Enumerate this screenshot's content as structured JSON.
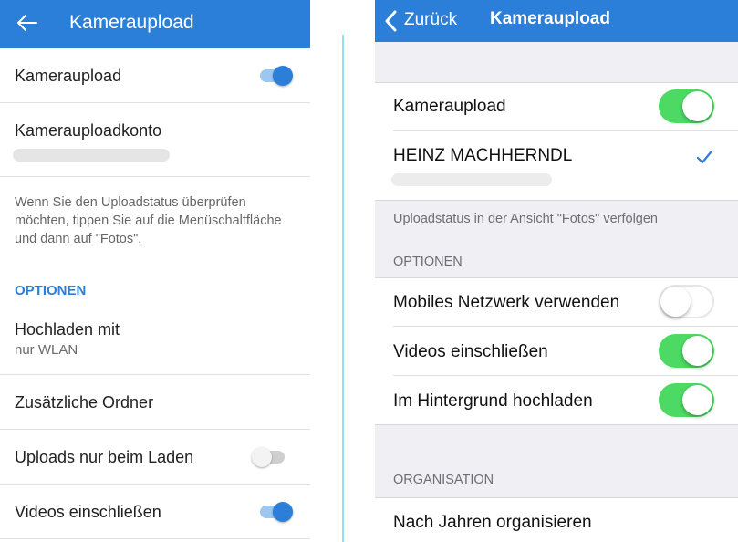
{
  "android": {
    "appbar": {
      "title": "Kameraupload",
      "back_icon": "arrow-left-icon"
    },
    "camera_upload": {
      "label": "Kameraupload",
      "enabled": true
    },
    "account": {
      "label": "Kamerauploadkonto"
    },
    "hint": "Wenn Sie den Uploadstatus überprüfen möchten, tippen Sie auf die Menüschaltfläche und dann auf \"Fotos\".",
    "options_header": "OPTIONEN",
    "upload_with": {
      "label": "Hochladen mit",
      "value": "nur WLAN"
    },
    "extra_folders": {
      "label": "Zusätzliche Ordner"
    },
    "uploads_charging": {
      "label": "Uploads nur beim Laden",
      "enabled": false
    },
    "include_videos": {
      "label": "Videos einschließen",
      "enabled": true
    },
    "accent_color": "#2b7fd8"
  },
  "ios": {
    "navbar": {
      "back_label": "Zurück",
      "title": "Kameraupload",
      "back_icon": "chevron-left-icon"
    },
    "camera_upload": {
      "label": "Kameraupload",
      "enabled": true
    },
    "account": {
      "name": "HEINZ MACHHERNDL",
      "selected": true,
      "check_icon": "checkmark-icon"
    },
    "status_caption": "Uploadstatus in der Ansicht \"Fotos\" verfolgen",
    "options_header": "OPTIONEN",
    "options": [
      {
        "label": "Mobiles Netzwerk verwenden",
        "enabled": false
      },
      {
        "label": "Videos einschließen",
        "enabled": true
      },
      {
        "label": "Im Hintergrund hochladen",
        "enabled": true
      }
    ],
    "organisation_header": "ORGANISATION",
    "organize_by_year": {
      "label": "Nach Jahren organisieren"
    },
    "accent_color": "#2b7fd8",
    "switch_on_color": "#4cd964"
  }
}
